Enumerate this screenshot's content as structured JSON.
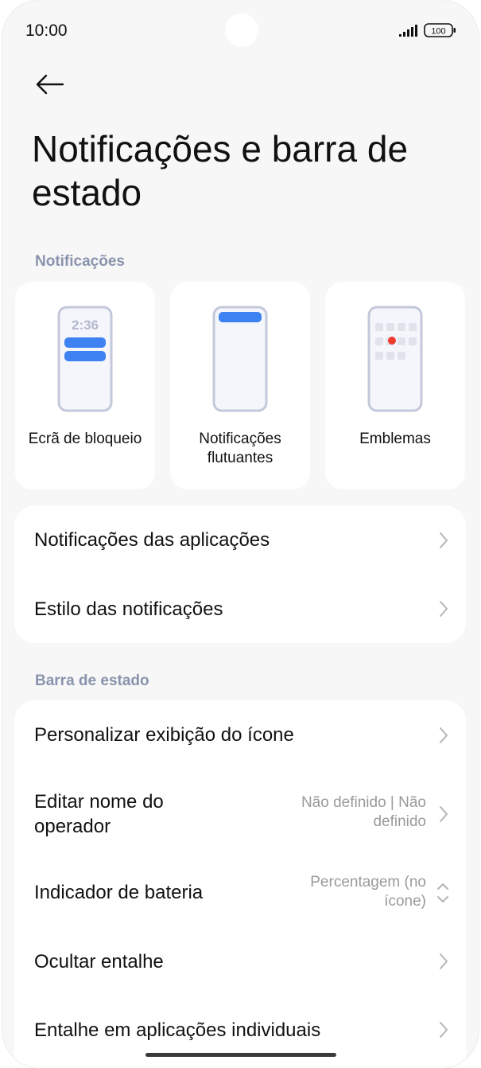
{
  "status_bar": {
    "time": "10:00",
    "battery": "100"
  },
  "page": {
    "title": "Notificações e barra de estado"
  },
  "notifications_section": {
    "header": "Notificações",
    "tiles": [
      {
        "label": "Ecrã de bloqueio",
        "preview_time": "2:36"
      },
      {
        "label": "Notificações flutuantes"
      },
      {
        "label": "Emblemas"
      }
    ],
    "rows": [
      {
        "label": "Notificações das aplicações"
      },
      {
        "label": "Estilo das notificações"
      }
    ]
  },
  "status_bar_section": {
    "header": "Barra de estado",
    "rows": [
      {
        "label": "Personalizar exibição do ícone"
      },
      {
        "label": "Editar nome do operador",
        "value": "Não definido | Não definido"
      },
      {
        "label": "Indicador de bateria",
        "value": "Percentagem (no ícone)"
      },
      {
        "label": "Ocultar entalhe"
      },
      {
        "label": "Entalhe em aplicações individuais"
      }
    ]
  },
  "colors": {
    "accent": "#3d82f0",
    "section_header": "#8a93ad",
    "badge_dot": "#f03c2e",
    "secondary_text": "#9a9a9a"
  }
}
